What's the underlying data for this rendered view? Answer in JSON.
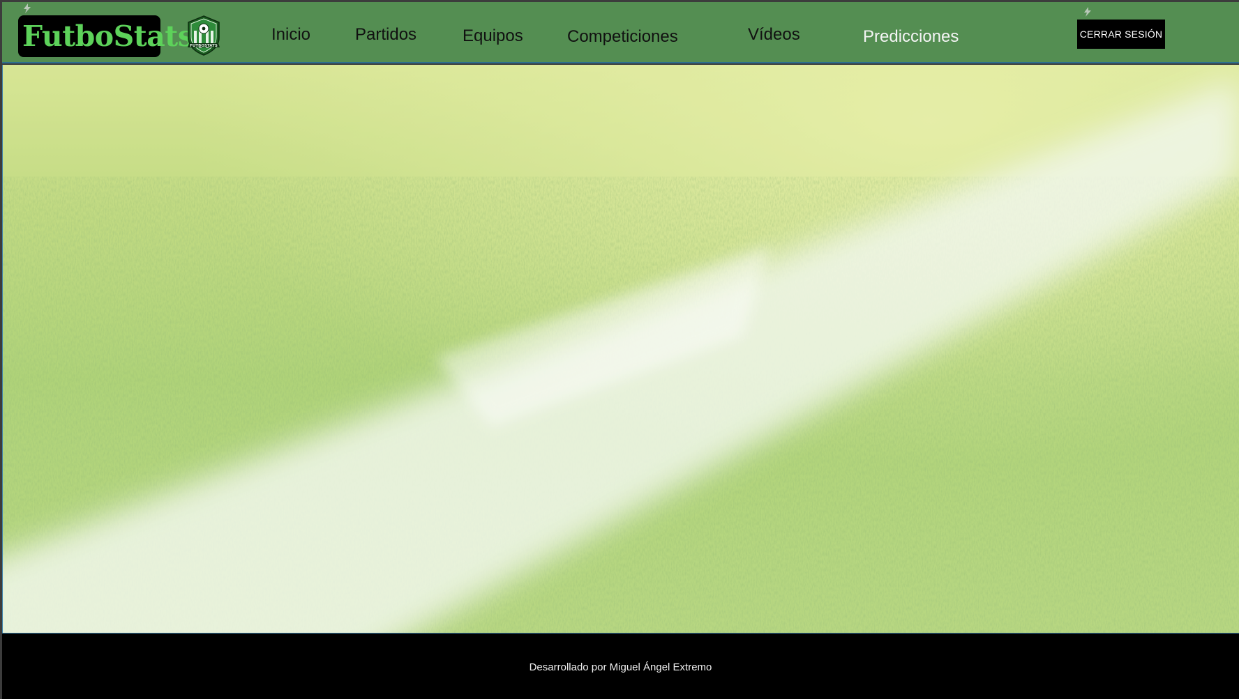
{
  "brand": {
    "name": "FutboStats",
    "crest_text": "FUTBOSTATS"
  },
  "nav": {
    "items": [
      {
        "label": "Inicio",
        "active": false
      },
      {
        "label": "Partidos",
        "active": false
      },
      {
        "label": "Equipos",
        "active": false
      },
      {
        "label": "Competiciones",
        "active": false
      },
      {
        "label": "Vídeos",
        "active": false
      },
      {
        "label": "Predicciones",
        "active": true
      }
    ],
    "logout_label": "CERRAR SESIÓN"
  },
  "footer": {
    "credit": "Desarrollado por Miguel Ángel Extremo"
  },
  "colors": {
    "navbar": "#548e52",
    "brand_text": "#5dd25a",
    "footer": "#000000",
    "accent_border": "#2d6f8f"
  }
}
